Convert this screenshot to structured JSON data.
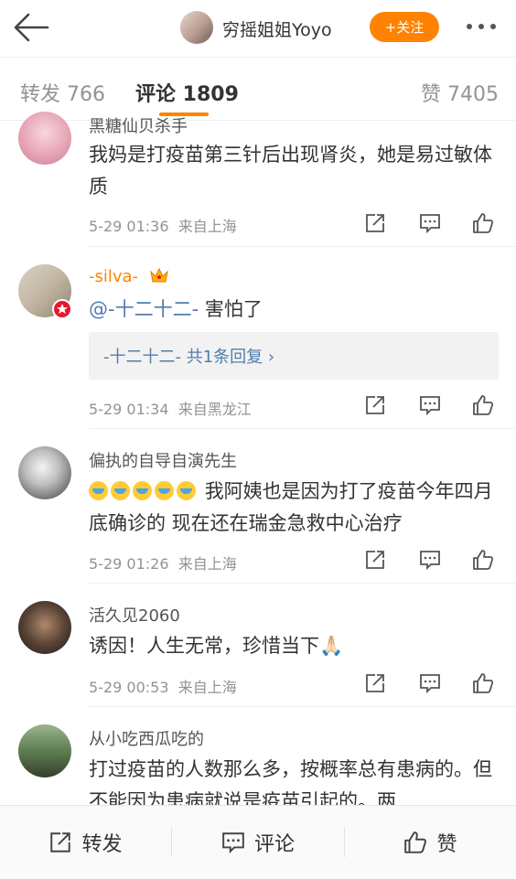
{
  "header": {
    "title": "穷摇姐姐Yoyo",
    "follow_label": "+关注"
  },
  "tabs": {
    "repost": "转发 766",
    "comments": "评论 1809",
    "likes": "赞 7405"
  },
  "comments": [
    {
      "name": "黑糖仙贝杀手",
      "text": "我妈是打疫苗第三针后出现肾炎，她是易过敏体质",
      "time": "5-29 01:36",
      "source": "来自上海"
    },
    {
      "name": "-silva-",
      "mention": "@-十二十二-",
      "text": " 害怕了",
      "reply_summary": "-十二十二-  共1条回复 ›",
      "time": "5-29 01:34",
      "source": "来自黑龙江"
    },
    {
      "name": "偏执的自导自演先生",
      "text": "我阿姨也是因为打了疫苗今年四月底确诊的 现在还在瑞金急救中心治疗",
      "time": "5-29 01:26",
      "source": "来自上海"
    },
    {
      "name": "活久见2060",
      "text": "诱因！人生无常，珍惜当下🙏🏻",
      "time": "5-29 00:53",
      "source": "来自上海"
    },
    {
      "name": "从小吃西瓜吃的",
      "text": "打过疫苗的人数那么多，按概率总有患病的。但不能因为患病就说是疫苗引起的。两"
    }
  ],
  "bottom": {
    "repost": "转发",
    "comment": "评论",
    "like": "赞"
  },
  "colors": {
    "accent": "#ff8200",
    "link": "#507daf",
    "muted": "#939393"
  }
}
